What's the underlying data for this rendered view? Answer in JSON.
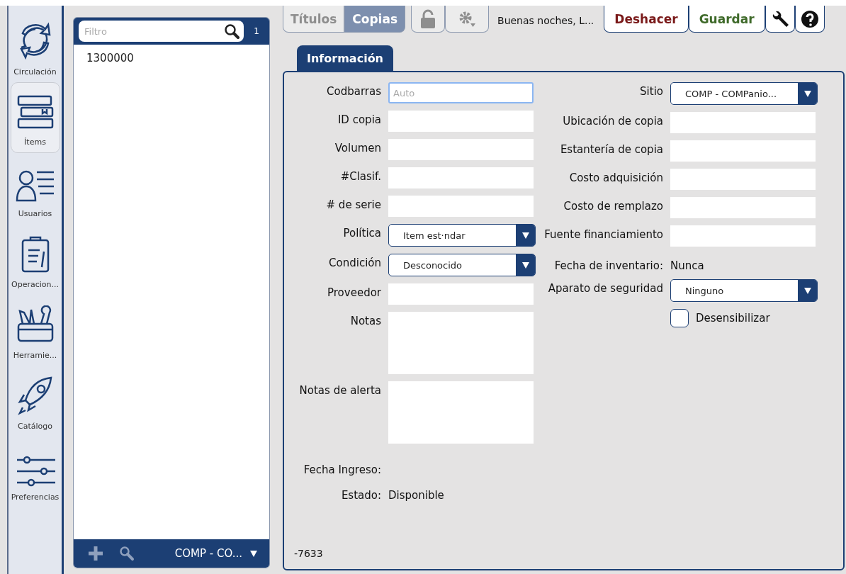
{
  "nav": {
    "items": [
      {
        "label": "Circulación",
        "selected": false
      },
      {
        "label": "Ítems",
        "selected": true
      },
      {
        "label": "Usuarios",
        "selected": false
      },
      {
        "label": "Operacion...",
        "selected": false
      },
      {
        "label": "Herramie...",
        "selected": false
      },
      {
        "label": "Catálogo",
        "selected": false
      },
      {
        "label": "Preferencias",
        "selected": false
      }
    ]
  },
  "list": {
    "filter": {
      "placeholder": "Filtro"
    },
    "count": "1",
    "items": [
      "1300000"
    ],
    "location": "COMP - CO..."
  },
  "toolbar": {
    "tabs": [
      {
        "label": "Títulos",
        "selected": false
      },
      {
        "label": "Copias",
        "selected": true
      }
    ],
    "greeting": "Buenas noches, L...",
    "buttons": [
      {
        "label": "Deshacer",
        "kind": "undo"
      },
      {
        "label": "Guardar",
        "kind": "save"
      }
    ]
  },
  "form": {
    "tab": "Información",
    "left": [
      {
        "label": "Codbarras",
        "kind": "input",
        "placeholder": "Auto"
      },
      {
        "label": "ID copia",
        "kind": "input"
      },
      {
        "label": "Volumen",
        "kind": "input"
      },
      {
        "label": "#Clasif.",
        "kind": "input"
      },
      {
        "label": "# de serie",
        "kind": "input"
      },
      {
        "label": "Política",
        "kind": "select",
        "value": "Item est·ndar"
      },
      {
        "label": "Condición",
        "kind": "select",
        "value": "Desconocido"
      },
      {
        "label": "Proveedor",
        "kind": "input"
      },
      {
        "label": "Notas",
        "kind": "textarea"
      },
      {
        "label": "Notas de alerta",
        "kind": "textarea"
      },
      {
        "label": "Fecha Ingreso:",
        "kind": "static"
      },
      {
        "label": "Estado:",
        "kind": "static",
        "value": "Disponible"
      }
    ],
    "right": [
      {
        "label": "Sitio",
        "kind": "select",
        "value": "COMP - COMPanio..."
      },
      {
        "label": "Ubicación de copia",
        "kind": "input"
      },
      {
        "label": "Estantería de copia",
        "kind": "input"
      },
      {
        "label": "Costo adquisición",
        "kind": "input"
      },
      {
        "label": "Costo de remplazo",
        "kind": "input"
      },
      {
        "label": "Fuente financiamiento",
        "kind": "input"
      },
      {
        "label": "Fecha de inventario:",
        "kind": "static",
        "value": "Nunca"
      },
      {
        "label": "Aparato de seguridad",
        "kind": "select",
        "value": "Ninguno"
      },
      {
        "label": "Desensibilizar",
        "kind": "checkbox",
        "checked": false
      }
    ],
    "footer": "-7633"
  }
}
